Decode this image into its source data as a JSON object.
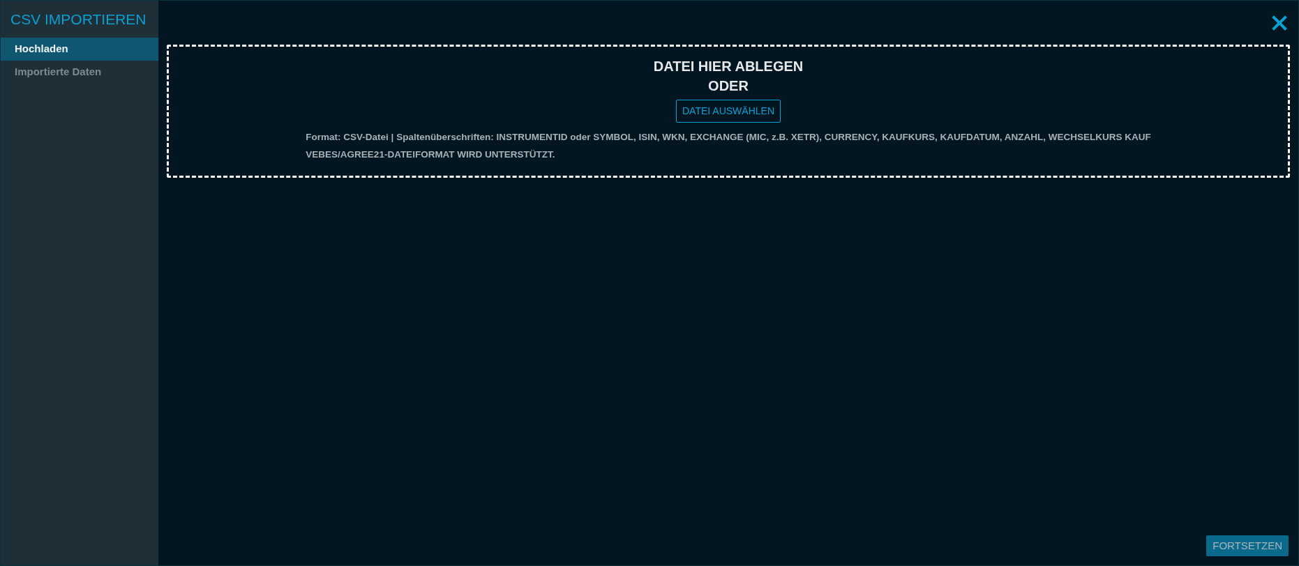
{
  "sidebar": {
    "title": "CSV IMPORTIEREN",
    "items": [
      {
        "label": "Hochladen",
        "selected": true
      },
      {
        "label": "Importierte Daten",
        "selected": false
      }
    ]
  },
  "dropzone": {
    "heading": "DATEI HIER ABLEGEN",
    "separator": "ODER",
    "button": "DATEI AUSWÄHLEN",
    "hints": [
      "Format: CSV-Datei | Spaltenüberschriften: INSTRUMENTID oder SYMBOL, ISIN, WKN, EXCHANGE (MIC, z.B. XETR), CURRENCY, KAUFKURS, KAUFDATUM, ANZAHL, WECHSELKURS KAUF",
      "VEBES/AGREE21-DATEIFORMAT WIRD UNTERSTÜTZT."
    ]
  },
  "continue_button": {
    "label": "FORTSETZEN",
    "disabled": true
  }
}
